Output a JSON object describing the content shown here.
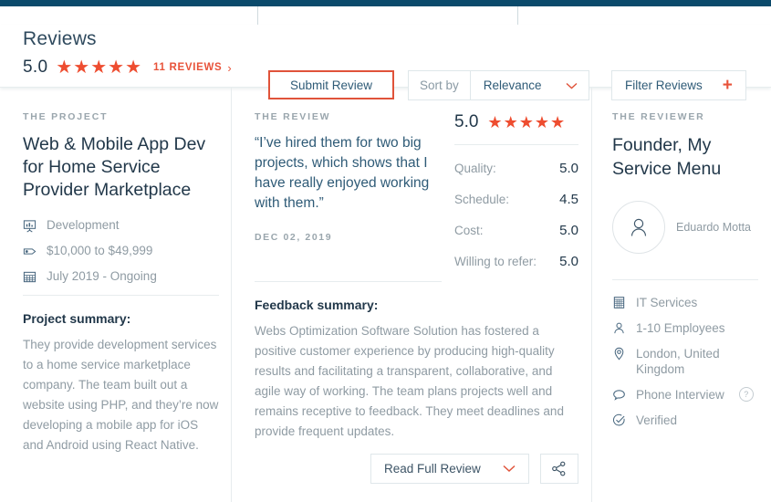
{
  "header": {
    "title": "Reviews",
    "rating": "5.0",
    "stars": 5,
    "review_count_label": "11 REVIEWS",
    "chevron": "›",
    "submit_button": "Submit Review",
    "sort_label": "Sort by",
    "sort_value": "Relevance",
    "sort_options": [
      "Relevance"
    ],
    "filter_button": "Filter Reviews",
    "accent_color": "#e8533a",
    "navy_color": "#0b4a6b"
  },
  "project": {
    "eyebrow": "THE PROJECT",
    "title": "Web & Mobile App Dev for Home Service Provider Marketplace",
    "meta": [
      {
        "icon": "presentation-icon",
        "text": "Development"
      },
      {
        "icon": "price-tag-icon",
        "text": "$10,000 to $49,999"
      },
      {
        "icon": "calendar-icon",
        "text": "July 2019 - Ongoing"
      }
    ],
    "summary_heading": "Project summary:",
    "summary_text": "They provide development services to a home service marketplace company. The team built out a website using PHP, and they’re now developing a mobile app for iOS and Android using React Native."
  },
  "review": {
    "eyebrow": "THE REVIEW",
    "quote": "“I’ve hired them for two big projects, which shows that I have really enjoyed working with them.”",
    "date": "DEC 02, 2019",
    "overall_rating": "5.0",
    "overall_stars": 5,
    "scores": [
      {
        "label": "Quality:",
        "value": "5.0"
      },
      {
        "label": "Schedule:",
        "value": "4.5"
      },
      {
        "label": "Cost:",
        "value": "5.0"
      },
      {
        "label": "Willing to refer:",
        "value": "5.0"
      }
    ],
    "feedback_heading": "Feedback summary:",
    "feedback_text": "Webs Optimization Software Solution has fostered a positive customer experience by producing high-quality results and facilitating a transparent, collaborative, and agile way of working. The team plans projects well and remains receptive to feedback. They meet deadlines and provide frequent updates.",
    "read_button": "Read Full Review",
    "share_icon": "share-icon"
  },
  "reviewer": {
    "eyebrow": "THE REVIEWER",
    "title": "Founder, My Service Menu",
    "name": "Eduardo Motta",
    "avatar_icon": "user-avatar-icon",
    "meta": [
      {
        "icon": "building-icon",
        "text": "IT Services",
        "help": false
      },
      {
        "icon": "person-icon",
        "text": "1-10 Employees",
        "help": false
      },
      {
        "icon": "location-pin-icon",
        "text": "London, United Kingdom",
        "help": false
      },
      {
        "icon": "speech-bubble-icon",
        "text": "Phone Interview",
        "help": true
      },
      {
        "icon": "check-circle-icon",
        "text": "Verified",
        "help": false
      }
    ]
  }
}
